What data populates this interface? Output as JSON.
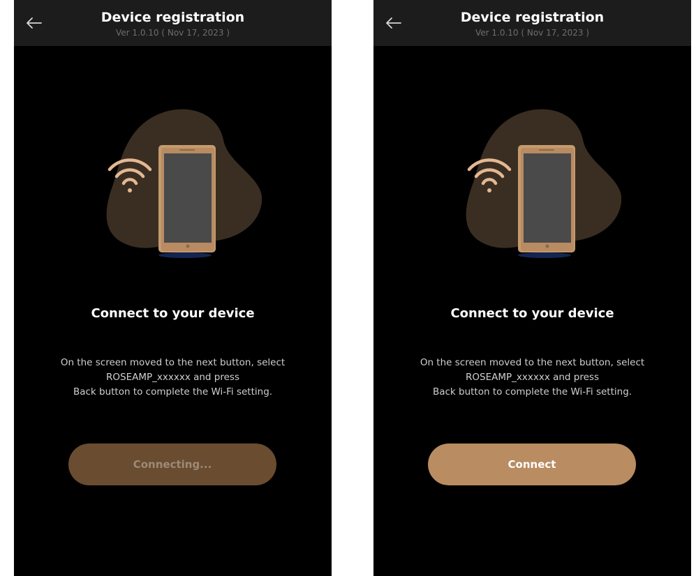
{
  "screens": [
    {
      "header": {
        "title": "Device registration",
        "version": "Ver 1.0.10 ( Nov 17, 2023 )"
      },
      "heading": "Connect to your device",
      "description": [
        "On the screen moved to the next button, select",
        "ROSEAMP_xxxxxx and press",
        "Back button to complete the Wi-Fi setting."
      ],
      "button": {
        "label": "Connecting...",
        "state": "disabled",
        "color": "#6a4c30"
      }
    },
    {
      "header": {
        "title": "Device registration",
        "version": "Ver 1.0.10 ( Nov 17, 2023 )"
      },
      "heading": "Connect to your device",
      "description": [
        "On the screen moved to the next button, select",
        "ROSEAMP_xxxxxx and press",
        "Back button to complete the Wi-Fi setting."
      ],
      "button": {
        "label": "Connect",
        "state": "active",
        "color": "#b98c61"
      }
    }
  ],
  "icons": {
    "back": "arrow-left-icon",
    "wifi": "wifi-icon",
    "phone": "smartphone-icon"
  },
  "colors": {
    "background": "#000000",
    "header": "#1c1c1c",
    "accent": "#b98c61"
  }
}
